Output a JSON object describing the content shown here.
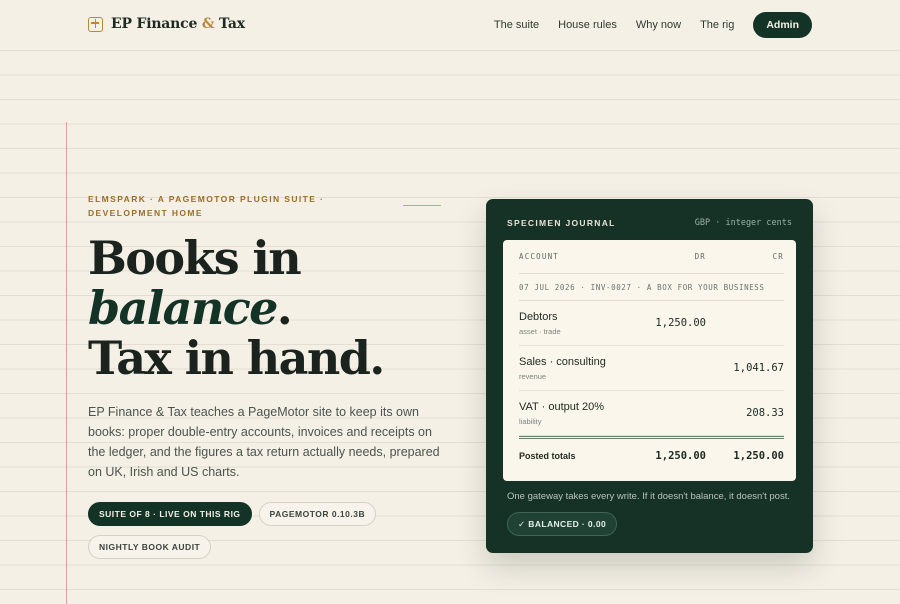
{
  "header": {
    "brand_first": "EP Finance ",
    "brand_amp": "&",
    "brand_last": " Tax",
    "nav": [
      "The suite",
      "House rules",
      "Why now",
      "The rig"
    ],
    "admin_label": "Admin"
  },
  "hero": {
    "eyebrow": "ELMSPARK · A PAGEMOTOR PLUGIN SUITE · DEVELOPMENT HOME",
    "headline_line1": "Books in",
    "headline_accent": "balance",
    "headline_period": ".",
    "headline_line3": "Tax in hand.",
    "lede": "EP Finance & Tax teaches a PageMotor site to keep its own books: proper double-entry accounts, invoices and receipts on the ledger, and the figures a tax return actually needs, prepared on UK, Irish and US charts.",
    "pills": [
      "SUITE OF 8 · LIVE ON THIS RIG",
      "PAGEMOTOR 0.10.3B",
      "NIGHTLY BOOK AUDIT"
    ]
  },
  "journal": {
    "title": "SPECIMEN JOURNAL",
    "meta": "GBP · integer cents",
    "columns": {
      "account": "ACCOUNT",
      "dr": "DR",
      "cr": "CR"
    },
    "entry_ref": "07 JUL 2026 · INV-0027 · A BOX FOR YOUR BUSINESS",
    "lines": [
      {
        "account": "Debtors",
        "type": "asset · trade",
        "dr": "1,250.00",
        "cr": ""
      },
      {
        "account": "Sales · consulting",
        "type": "revenue",
        "dr": "",
        "cr": "1,041.67"
      },
      {
        "account": "VAT · output 20%",
        "type": "liability",
        "dr": "",
        "cr": "208.33"
      }
    ],
    "totals": {
      "label": "Posted totals",
      "dr": "1,250.00",
      "cr": "1,250.00"
    },
    "gateway_note": "One gateway takes every write. If it doesn't balance, it doesn't post.",
    "balanced_badge": "✓ BALANCED · 0.00"
  }
}
